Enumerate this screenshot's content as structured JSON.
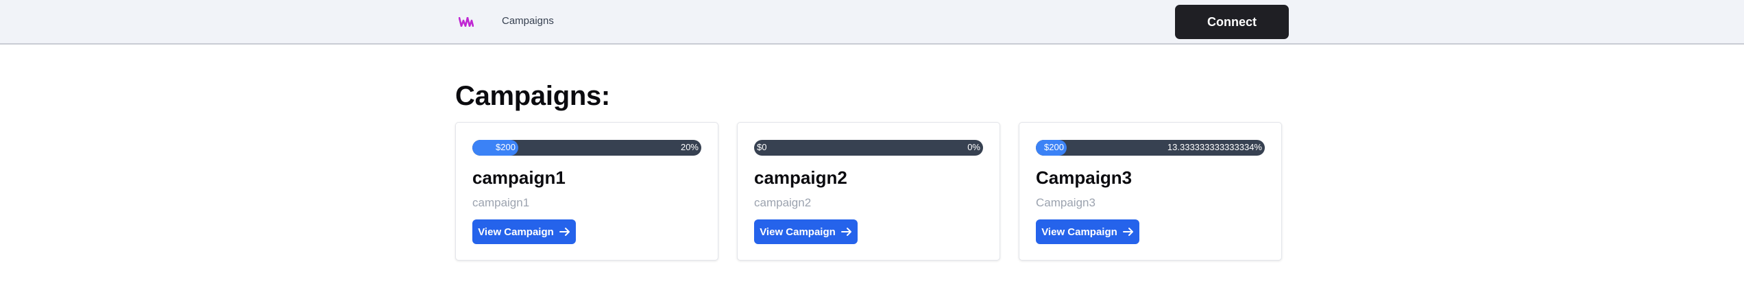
{
  "navbar": {
    "logo_icon": "wm-logo-icon",
    "logo_color": "#c026d3",
    "links": [
      {
        "label": "Campaigns"
      }
    ],
    "connect_label": "Connect"
  },
  "page": {
    "title": "Campaigns:"
  },
  "campaigns": [
    {
      "amount": "$200",
      "percent_label": "20%",
      "progress": 0.2,
      "title": "campaign1",
      "description": "campaign1",
      "button_label": "View Campaign",
      "button_icon": "arrow-right-icon"
    },
    {
      "amount": "$0",
      "percent_label": "0%",
      "progress": 0.0,
      "title": "campaign2",
      "description": "campaign2",
      "button_label": "View Campaign",
      "button_icon": "arrow-right-icon"
    },
    {
      "amount": "$200",
      "percent_label": "13.333333333333334%",
      "progress": 0.1333,
      "title": "Campaign3",
      "description": "Campaign3",
      "button_label": "View Campaign",
      "button_icon": "arrow-right-icon"
    }
  ],
  "colors": {
    "accent_blue": "#2563eb",
    "progress_fill": "#3b82f6",
    "progress_track": "#374151",
    "connect_bg": "#1f1f24",
    "navbar_bg": "#f1f3f8"
  }
}
